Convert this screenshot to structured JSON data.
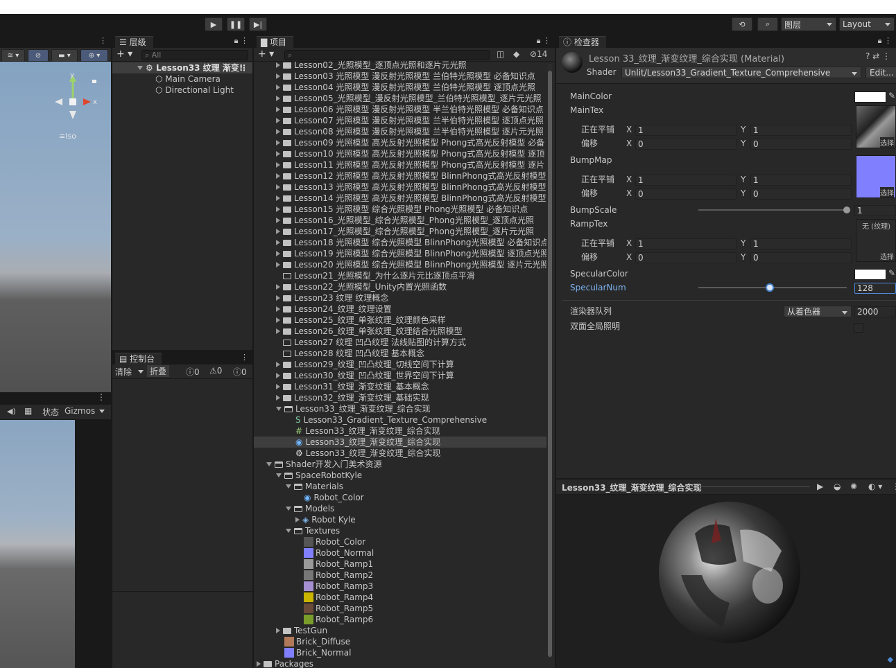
{
  "toolbar": {
    "layers": "图层",
    "layout": "Layout"
  },
  "scene_view": {
    "axis_y": "y",
    "axis_x": "x",
    "iso": "≡Iso"
  },
  "game_bar": {
    "status": "状态",
    "gizmos": "Gizmos"
  },
  "hierarchy": {
    "tab": "层级",
    "search_placeholder": "All",
    "scene": "Lesson33 纹理 渐变!",
    "items": [
      "Main Camera",
      "Directional Light"
    ]
  },
  "console": {
    "tab": "控制台",
    "clear": "清除",
    "collapse": "折叠",
    "count_log": "0",
    "count_warn": "0",
    "count_err": "0"
  },
  "project": {
    "tab": "项目",
    "hidden_count": "14",
    "lessons": [
      {
        "label": "Lesson02_光照模型_逐顶点光照和逐片元光照",
        "arrow": true,
        "folder": "full"
      },
      {
        "label": "Lesson03 光照模型 漫反射光照模型 兰伯特光照模型 必备知识点",
        "arrow": true,
        "folder": "full"
      },
      {
        "label": "Lesson04 光照模型 漫反射光照模型 兰伯特光照模型 逐顶点光照",
        "arrow": true,
        "folder": "full"
      },
      {
        "label": "Lesson05_光照模型_漫反射光照模型_兰伯特光照模型_逐片元光照",
        "arrow": true,
        "folder": "full"
      },
      {
        "label": "Lesson06 光照模型 漫反射光照模型 半兰伯特光照模型 必备知识点",
        "arrow": true,
        "folder": "full"
      },
      {
        "label": "Lesson07 光照模型 漫反射光照模型 兰半伯特光照模型 逐顶点光照",
        "arrow": true,
        "folder": "full"
      },
      {
        "label": "Lesson08 光照模型 漫反射光照模型 兰半伯特光照模型 逐片元光照",
        "arrow": true,
        "folder": "full"
      },
      {
        "label": "Lesson09 光照模型 高光反射光照模型 Phong式高光反射模型 必备",
        "arrow": true,
        "folder": "full"
      },
      {
        "label": "Lesson10 光照模型 高光反射光照模型 Phong式高光反射模型 逐顶",
        "arrow": true,
        "folder": "full"
      },
      {
        "label": "Lesson11 光照模型 高光反射光照模型 Phong式高光反射模型 逐片",
        "arrow": true,
        "folder": "full"
      },
      {
        "label": "Lesson12 光照模型 高光反射光照模型 BlinnPhong式高光反射模型",
        "arrow": true,
        "folder": "full"
      },
      {
        "label": "Lesson13 光照模型 高光反射光照模型 BlinnPhong式高光反射模型",
        "arrow": true,
        "folder": "full"
      },
      {
        "label": "Lesson14 光照模型 高光反射光照模型 BlinnPhong式高光反射模型",
        "arrow": true,
        "folder": "full"
      },
      {
        "label": "Lesson15 光照模型 综合光照模型 Phong光照模型 必备知识点",
        "arrow": true,
        "folder": "full"
      },
      {
        "label": "Lesson16_光照模型_综合光照模型_Phong光照模型_逐顶点光照",
        "arrow": true,
        "folder": "full"
      },
      {
        "label": "Lesson17_光照模型_综合光照模型_Phong光照模型_逐片元光照",
        "arrow": true,
        "folder": "full"
      },
      {
        "label": "Lesson18 光照模型 综合光照模型 BlinnPhong光照模型 必备知识点",
        "arrow": true,
        "folder": "full"
      },
      {
        "label": "Lesson19 光照模型 综合光照模型 BlinnPhong光照模型 逐顶点光照",
        "arrow": true,
        "folder": "full"
      },
      {
        "label": "Lesson20 光照模型 综合光照模型 BlinnPhong光照模型 逐片元光照",
        "arrow": true,
        "folder": "full"
      },
      {
        "label": "Lesson21_光照模型_为什么逐片元比逐顶点平滑",
        "arrow": false,
        "folder": "empty"
      },
      {
        "label": "Lesson22_光照模型_Unity内置光照函数",
        "arrow": true,
        "folder": "full"
      },
      {
        "label": "Lesson23 纹理 纹理概念",
        "arrow": true,
        "folder": "full"
      },
      {
        "label": "Lesson24_纹理_纹理设置",
        "arrow": true,
        "folder": "full"
      },
      {
        "label": "Lesson25_纹理_单张纹理_纹理颜色采样",
        "arrow": true,
        "folder": "full"
      },
      {
        "label": "Lesson26_纹理_单张纹理_纹理结合光照模型",
        "arrow": true,
        "folder": "full"
      },
      {
        "label": "Lesson27 纹理 凹凸纹理 法线贴图的计算方式",
        "arrow": false,
        "folder": "empty"
      },
      {
        "label": "Lesson28 纹理 凹凸纹理 基本概念",
        "arrow": false,
        "folder": "empty"
      },
      {
        "label": "Lesson29_纹理_凹凸纹理_切线空间下计算",
        "arrow": true,
        "folder": "full"
      },
      {
        "label": "Lesson30_纹理_凹凸纹理_世界空间下计算",
        "arrow": true,
        "folder": "full"
      },
      {
        "label": "Lesson31_纹理_渐变纹理_基本概念",
        "arrow": true,
        "folder": "full"
      },
      {
        "label": "Lesson32_纹理_渐变纹理_基础实现",
        "arrow": true,
        "folder": "full"
      },
      {
        "label": "Lesson33_纹理_渐变纹理_综合实现",
        "arrow": "open",
        "folder": "open"
      }
    ],
    "lesson33_children": [
      "Lesson33_Gradient_Texture_Comprehensive",
      "Lesson33_纹理_渐变纹理_综合实现",
      "Lesson33_纹理_渐变纹理_综合实现",
      "Lesson33_纹理_渐变纹理_综合实现"
    ],
    "shader_res": "Shader开发入门美术资源",
    "space_robot": "SpaceRobotKyle",
    "materials": "Materials",
    "robot_color_mat": "Robot_Color",
    "models": "Models",
    "robot_kyle": "Robot Kyle",
    "textures": "Textures",
    "textures_list": [
      {
        "label": "Robot_Color",
        "color": "#555555"
      },
      {
        "label": "Robot_Normal",
        "color": "#8080ff"
      },
      {
        "label": "Robot_Ramp1",
        "color": "#9a9a9a"
      },
      {
        "label": "Robot_Ramp2",
        "color": "#777777"
      },
      {
        "label": "Robot_Ramp3",
        "color": "#a58fd0"
      },
      {
        "label": "Robot_Ramp4",
        "color": "#c9b400"
      },
      {
        "label": "Robot_Ramp5",
        "color": "#6b4a3a"
      },
      {
        "label": "Robot_Ramp6",
        "color": "#7a9c2a"
      }
    ],
    "testgun": "TestGun",
    "brick_diffuse": "Brick_Diffuse",
    "brick_normal": "Brick_Normal",
    "packages": "Packages"
  },
  "inspector": {
    "tab": "检查器",
    "material_title": "Lesson 33_纹理_渐变纹理_综合实现 (Material)",
    "shader_label": "Shader",
    "shader_value": "Unlit/Lesson33_Gradient_Texture_Comprehensive",
    "edit": "Edit...",
    "main_color": "MainColor",
    "main_tex": "MainTex",
    "tiling": "正在平铺",
    "offset": "偏移",
    "x": "X",
    "y": "Y",
    "main_tiling_x": "1",
    "main_tiling_y": "1",
    "main_offset_x": "0",
    "main_offset_y": "0",
    "bump_map": "BumpMap",
    "bump_tiling_x": "1",
    "bump_tiling_y": "1",
    "bump_offset_x": "0",
    "bump_offset_y": "0",
    "bump_scale": "BumpScale",
    "bump_scale_value": "1",
    "bump_scale_fraction": 1.0,
    "ramp_tex": "RampTex",
    "ramp_none": "无 (纹理)",
    "ramp_tiling_x": "1",
    "ramp_tiling_y": "1",
    "ramp_offset_x": "0",
    "ramp_offset_y": "0",
    "select": "选择",
    "specular_color": "SpecularColor",
    "specular_num": "SpecularNum",
    "specular_num_value": "128",
    "specular_num_fraction": 0.48,
    "render_queue": "渲染器队列",
    "render_queue_mode": "从着色器",
    "render_queue_value": "2000",
    "double_gi": "双面全局照明"
  },
  "preview": {
    "title": "Lesson33_纹理_渐变纹理_综合实现"
  },
  "colors": {
    "accent_blue": "#4d8ad8",
    "bumpmap": "#8080ff",
    "specular_label": "#7cb2f0"
  }
}
